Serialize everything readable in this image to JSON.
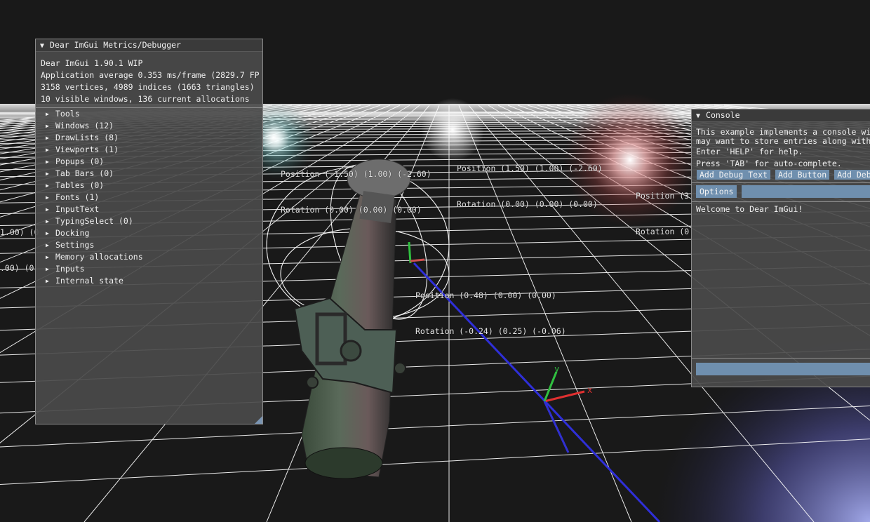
{
  "scene": {
    "labels": [
      {
        "position": "Position (-1.50) (1.00) (-2.60)",
        "rotation": "Rotation (0.00) (0.00) (0.00)"
      },
      {
        "position": "Position (1.50) (1.00) (-2.60)",
        "rotation": "Rotation (0.00) (0.00) (0.00)"
      },
      {
        "position": "Position (3",
        "rotation": "Rotation (0"
      },
      {
        "position": "1.00) (0",
        "rotation": ".00) (0"
      },
      {
        "position": "Position (0.48) (0.00) (0.00)",
        "rotation": "Rotation (-0.24) (0.25) (-0.06)"
      }
    ],
    "gizmo_axes": {
      "x": "x",
      "y": "y"
    }
  },
  "metrics": {
    "title": "Dear ImGui Metrics/Debugger",
    "version": "Dear ImGui 1.90.1 WIP",
    "perf": "Application average 0.353 ms/frame (2829.7 FP",
    "geometry": "3158 vertices, 4989 indices (1663 triangles)",
    "windows_info": "10 visible windows, 136 current allocations",
    "tree": [
      "Tools",
      "Windows (12)",
      "DrawLists (8)",
      "Viewports (1)",
      "Popups (0)",
      "Tab Bars (0)",
      "Tables (0)",
      "Fonts (1)",
      "InputText",
      "TypingSelect (0)",
      "Docking",
      "Settings",
      "Memory allocations",
      "Inputs",
      "Internal state"
    ]
  },
  "console": {
    "title": "Console",
    "desc1": "This example implements a console wi",
    "desc2": "may want to store entries along with",
    "help": "Enter 'HELP' for help.",
    "tab": "Press 'TAB' for auto-complete.",
    "buttons": [
      "Add Debug Text",
      "Add Button",
      "Add Deb"
    ],
    "options": "Options",
    "welcome": "Welcome to Dear ImGui!"
  },
  "colors": {
    "window_bg": "#4a4a4a",
    "title_bg": "#3a3a3a",
    "button": "#6f8fae",
    "axis_x": "#e03030",
    "axis_y": "#30c040",
    "axis_z": "#3030d0"
  }
}
